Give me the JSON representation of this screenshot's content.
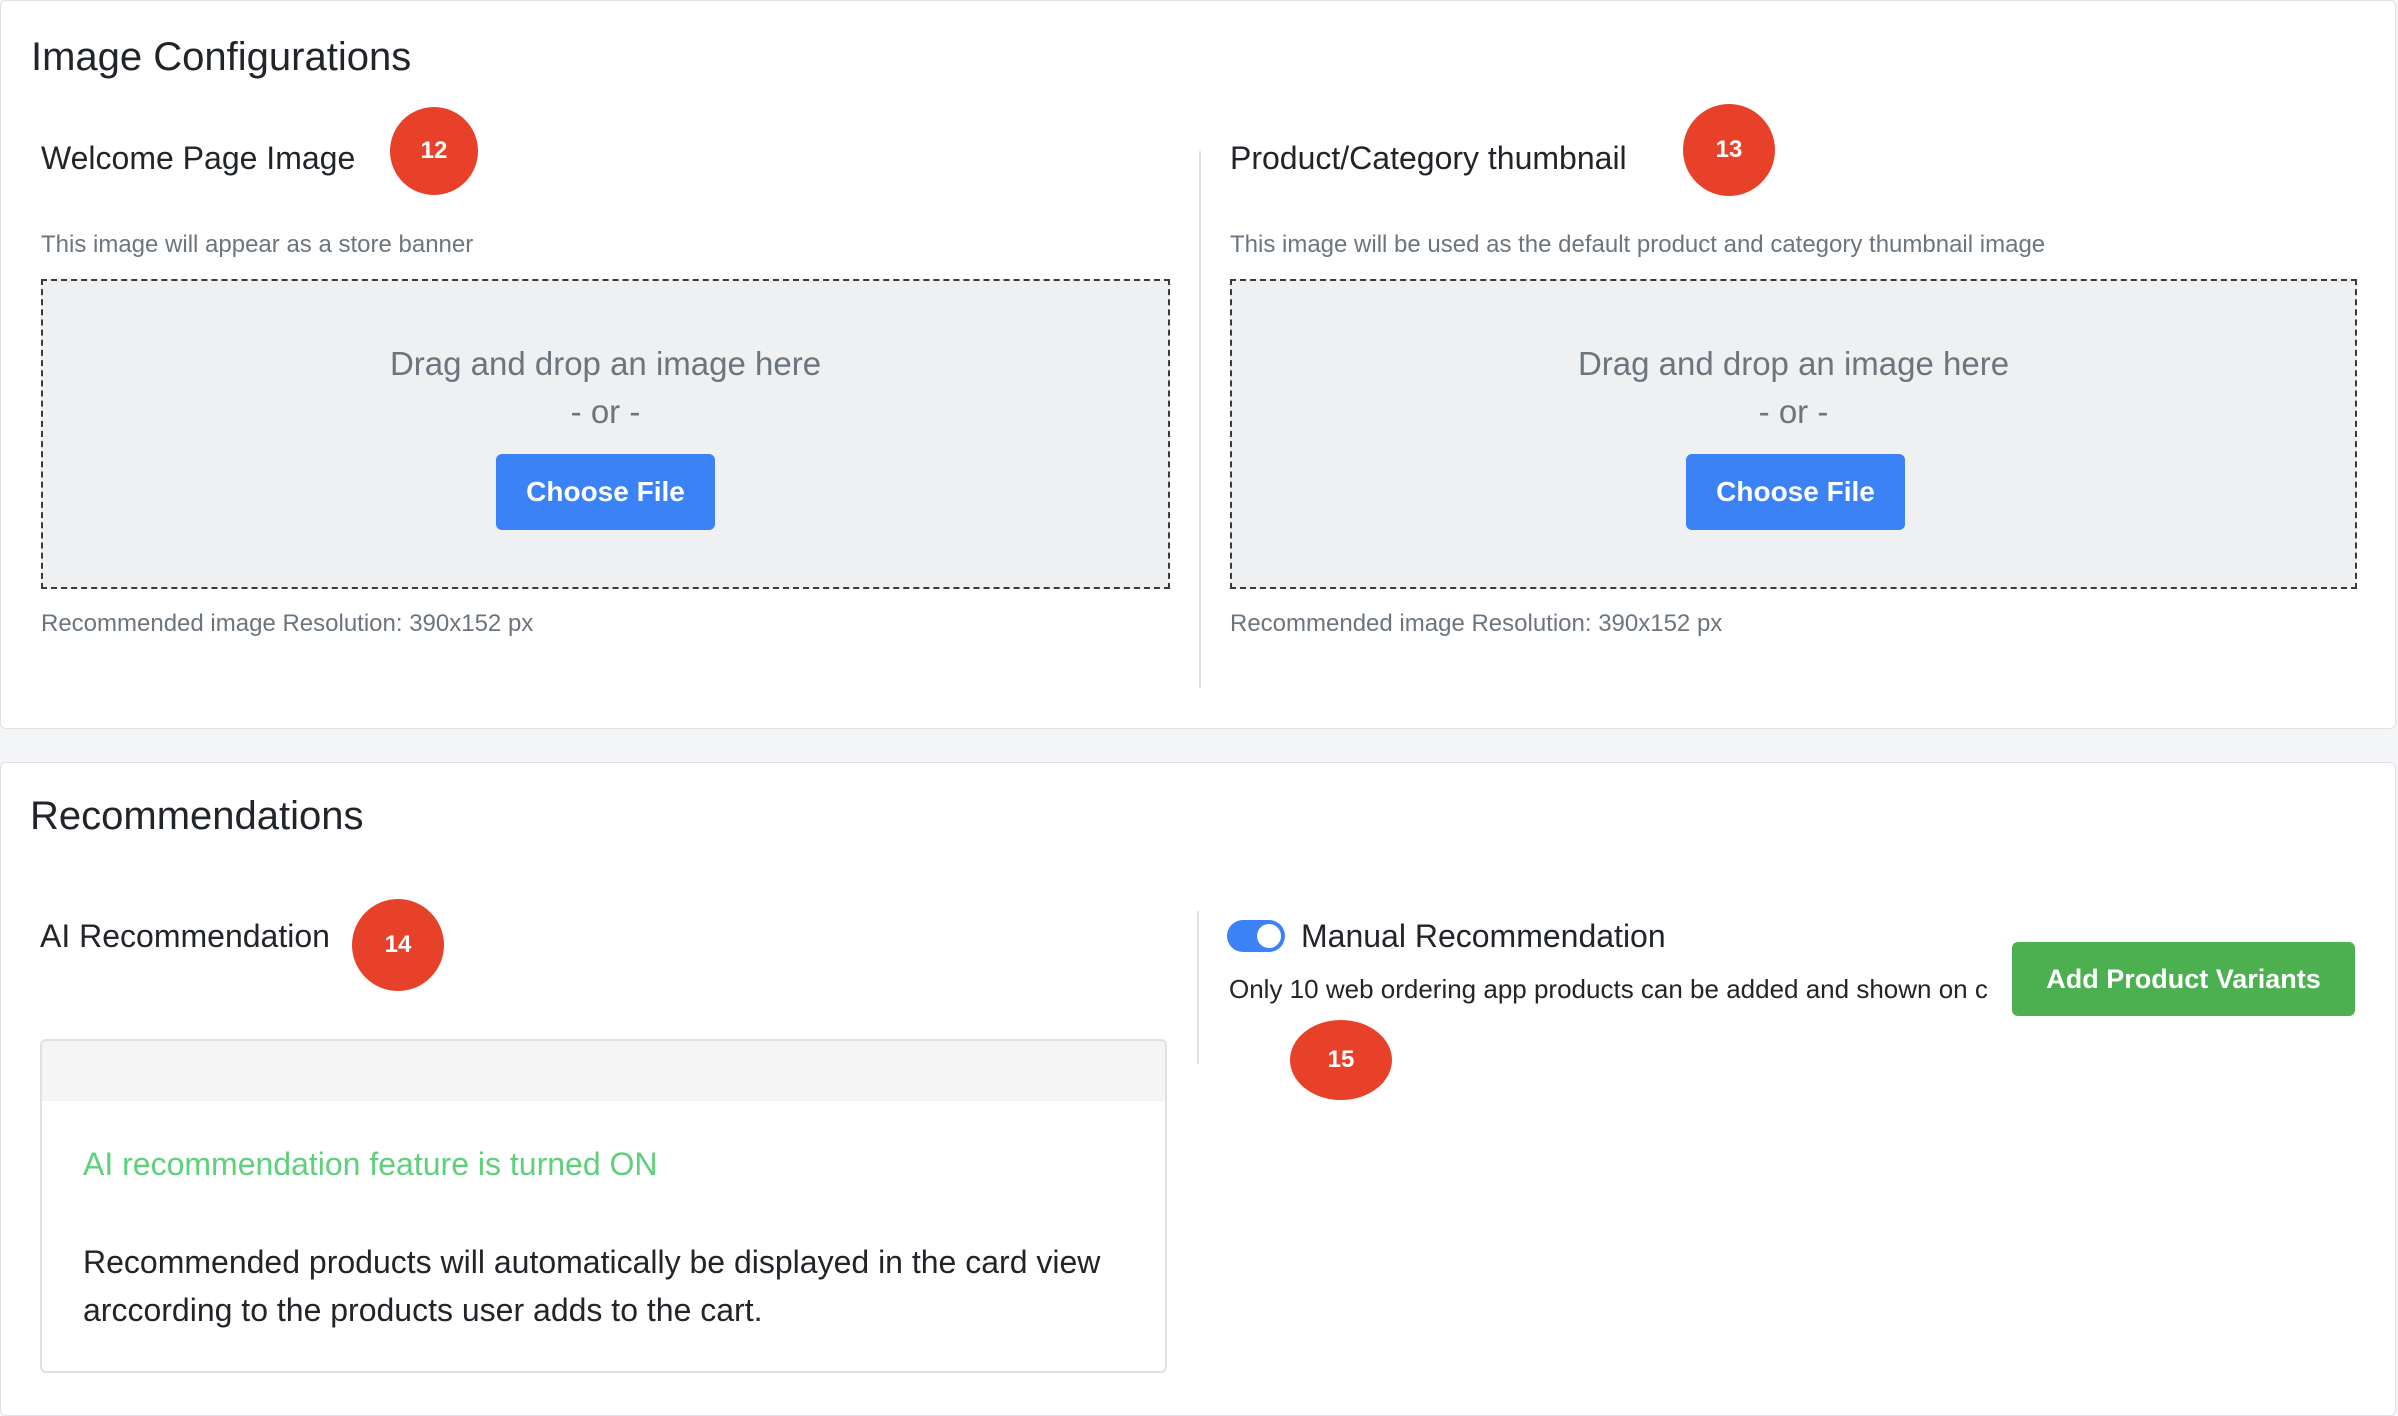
{
  "image_config": {
    "title": "Image Configurations",
    "welcome": {
      "title": "Welcome Page Image",
      "badge": "12",
      "hint": "This image will appear as a store banner",
      "drop_text": "Drag and drop an image here",
      "or_text": "- or -",
      "button": "Choose File",
      "resolution": "Recommended image Resolution: 390x152 px"
    },
    "thumbnail": {
      "title": "Product/Category thumbnail",
      "badge": "13",
      "hint": "This image will be used as the default product and category thumbnail image",
      "drop_text": "Drag and drop an image here",
      "or_text": "- or -",
      "button": "Choose File",
      "resolution": "Recommended image Resolution: 390x152 px"
    }
  },
  "recommendations": {
    "title": "Recommendations",
    "ai": {
      "title": "AI Recommendation",
      "badge": "14",
      "status": "AI recommendation feature is turned ON",
      "description": "Recommended products will automatically be displayed in the card view arccording to the products user adds to the cart."
    },
    "manual": {
      "title": "Manual Recommendation",
      "toggle_on": true,
      "description": "Only 10 web ordering app products can be added and shown on c",
      "button": "Add Product Variants",
      "badge": "15"
    }
  },
  "colors": {
    "primary": "#3b82f6",
    "success_button": "#4caf50",
    "badge": "#e8412a",
    "status_text": "#5fd07a"
  }
}
